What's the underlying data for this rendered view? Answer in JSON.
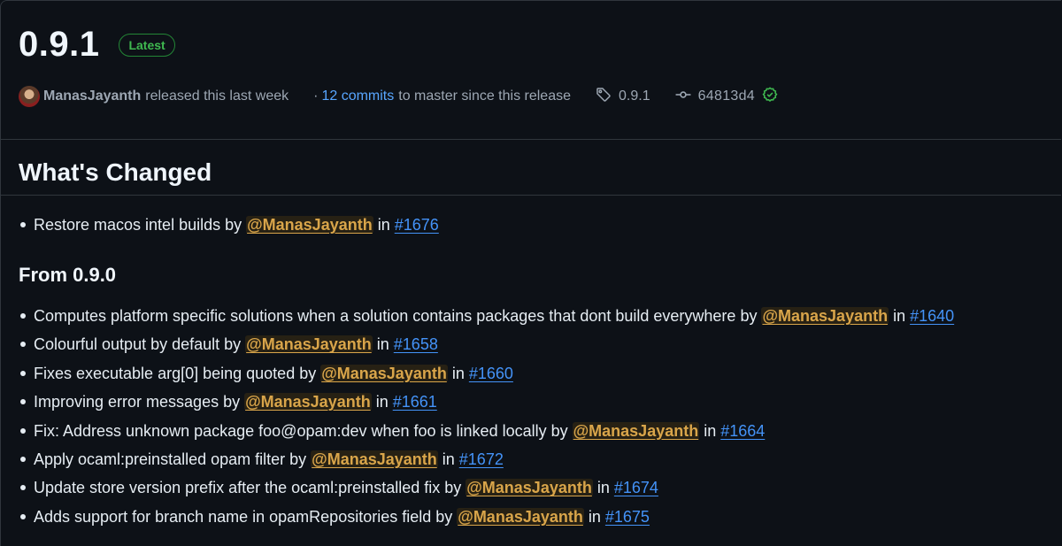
{
  "release": {
    "version": "0.9.1",
    "badge": "Latest",
    "author": "ManasJayanth",
    "released_text": "released this last week",
    "dot": "·",
    "commits_link": "12 commits",
    "commits_suffix": "to master since this release",
    "tag": "0.9.1",
    "commit_sha": "64813d4"
  },
  "body": {
    "heading": "What's Changed",
    "changes": [
      {
        "text": "Restore macos intel builds by ",
        "mention": "@ManasJayanth",
        "in": " in ",
        "pr": "#1676"
      }
    ],
    "subheading": "From 0.9.0",
    "from_changes": [
      {
        "text": "Computes platform specific solutions when a solution contains packages that dont build everywhere by ",
        "mention": "@ManasJayanth",
        "in": " in ",
        "pr": "#1640"
      },
      {
        "text": "Colourful output by default by ",
        "mention": "@ManasJayanth",
        "in": " in ",
        "pr": "#1658"
      },
      {
        "text": "Fixes executable arg[0] being quoted by ",
        "mention": "@ManasJayanth",
        "in": " in ",
        "pr": "#1660"
      },
      {
        "text": "Improving error messages by ",
        "mention": "@ManasJayanth",
        "in": " in ",
        "pr": "#1661"
      },
      {
        "text": "Fix: Address unknown package foo@opam:dev when foo is linked locally by ",
        "mention": "@ManasJayanth",
        "in": " in ",
        "pr": "#1664"
      },
      {
        "text": "Apply ocaml:preinstalled opam filter by ",
        "mention": "@ManasJayanth",
        "in": " in ",
        "pr": "#1672"
      },
      {
        "text": "Update store version prefix after the ocaml:preinstalled fix by ",
        "mention": "@ManasJayanth",
        "in": " in ",
        "pr": "#1674"
      },
      {
        "text": "Adds support for branch name in opamRepositories field by ",
        "mention": "@ManasJayanth",
        "in": " in ",
        "pr": "#1675"
      }
    ]
  },
  "icons": {
    "tag": "tag-icon",
    "commit": "git-commit-icon",
    "verified": "check-circle-icon"
  },
  "colors": {
    "background": "#0d1117",
    "link": "#4493f8",
    "mention": "#d9a54a",
    "badge_green": "#3fb950"
  }
}
